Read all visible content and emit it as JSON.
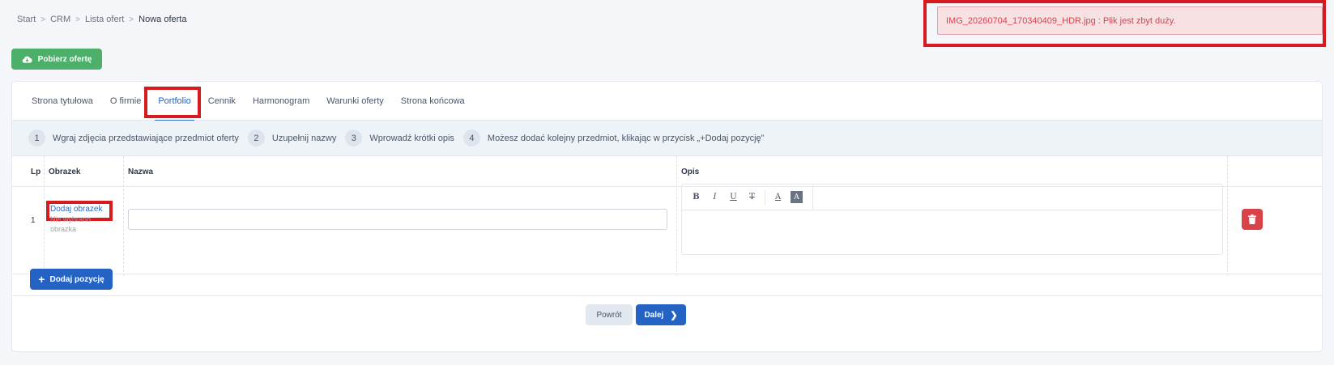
{
  "breadcrumb": [
    "Start",
    "CRM",
    "Lista ofert",
    "Nowa oferta"
  ],
  "alert": {
    "message": "IMG_20260704_170340409_HDR.jpg : Plik jest zbyt duży."
  },
  "download_button": {
    "label": "Pobierz ofertę",
    "icon": "cloud-download-icon"
  },
  "tabs": [
    {
      "label": "Strona tytułowa"
    },
    {
      "label": "O firmie"
    },
    {
      "label": "Portfolio",
      "active": true
    },
    {
      "label": "Cennik"
    },
    {
      "label": "Harmonogram"
    },
    {
      "label": "Warunki oferty"
    },
    {
      "label": "Strona końcowa"
    }
  ],
  "steps": [
    {
      "num": "1",
      "text": "Wgraj zdjęcia przedstawiające przedmiot oferty"
    },
    {
      "num": "2",
      "text": "Uzupełnij nazwy"
    },
    {
      "num": "3",
      "text": "Wprowadź krótki opis"
    },
    {
      "num": "4",
      "text": "Możesz dodać kolejny przedmiot, klikając w przycisk „+Dodaj pozycję”"
    }
  ],
  "table": {
    "headers": {
      "lp": "Lp",
      "image": "Obrazek",
      "name": "Nazwa",
      "desc": "Opis"
    },
    "rows": [
      {
        "lp": "1",
        "add_image": "Dodaj obrazek",
        "no_image": "Nie wybrano obrazka",
        "name": "",
        "desc": ""
      }
    ]
  },
  "editor_toolbar": [
    "B",
    "I",
    "U",
    "T",
    "A",
    "A"
  ],
  "add_position_button": "Dodaj pozycję",
  "back_button": "Powrót",
  "next_button": "Dalej",
  "colors": {
    "green": "#4caf6a",
    "primary": "#2462c4",
    "danger": "#d94348",
    "highlight": "#d71920"
  }
}
